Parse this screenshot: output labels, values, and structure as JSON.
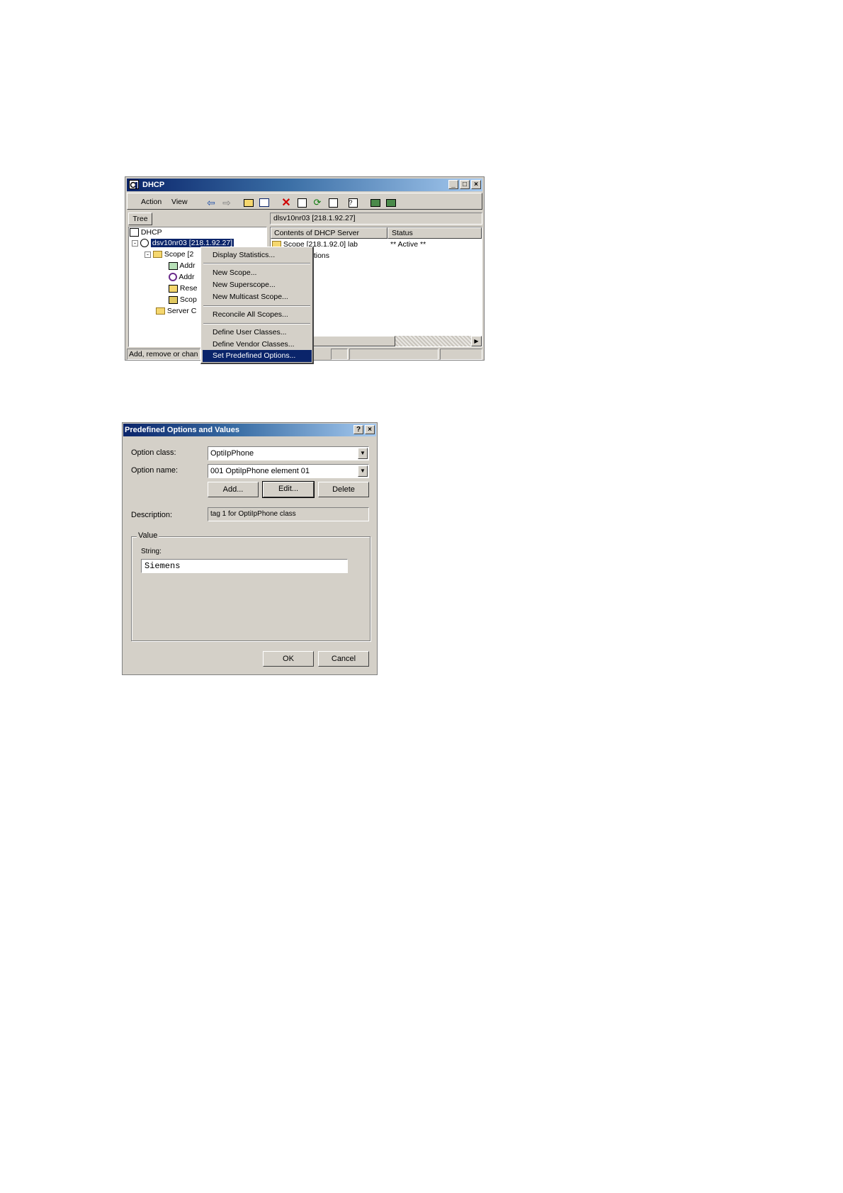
{
  "dhcp_window": {
    "title": "DHCP",
    "menu": [
      "Action",
      "View"
    ],
    "tree_tab": "Tree",
    "right_header": "dlsv10nr03 [218.1.92.27]",
    "columns": [
      "Contents of DHCP Server",
      "Status"
    ],
    "rows": [
      {
        "name": "Scope [218.1.92.0] lab",
        "status": "** Active **"
      },
      {
        "name": "ptions",
        "status": ""
      }
    ],
    "tree": {
      "root": "DHCP",
      "server": "dsv10nr03 [218.1.92.27]",
      "children": [
        "Scope [2",
        "Addr",
        "Addr",
        "Rese",
        "Scop",
        "Server C"
      ]
    },
    "status_text": "Add, remove or chan",
    "context_menu": {
      "groups": [
        [
          "Display Statistics..."
        ],
        [
          "New Scope...",
          "New Superscope...",
          "New Multicast Scope..."
        ],
        [
          "Reconcile All Scopes..."
        ],
        [
          "Define User Classes...",
          "Define Vendor Classes...",
          "Set Predefined Options..."
        ]
      ],
      "selected": "Set Predefined Options..."
    }
  },
  "options_dialog": {
    "title": "Predefined Options and Values",
    "option_class_label": "Option class:",
    "option_class_value": "OptiIpPhone",
    "option_name_label": "Option name:",
    "option_name_value": "001 OptiIpPhone element 01",
    "add_label": "Add...",
    "edit_label": "Edit...",
    "delete_label": "Delete",
    "description_label": "Description:",
    "description_value": "tag 1 for OptiIpPhone class",
    "value_group_label": "Value",
    "string_label": "String:",
    "string_value": "Siemens",
    "ok_label": "OK",
    "cancel_label": "Cancel"
  },
  "colors": {
    "selection": "#0a246a",
    "face": "#d4d0c8"
  }
}
